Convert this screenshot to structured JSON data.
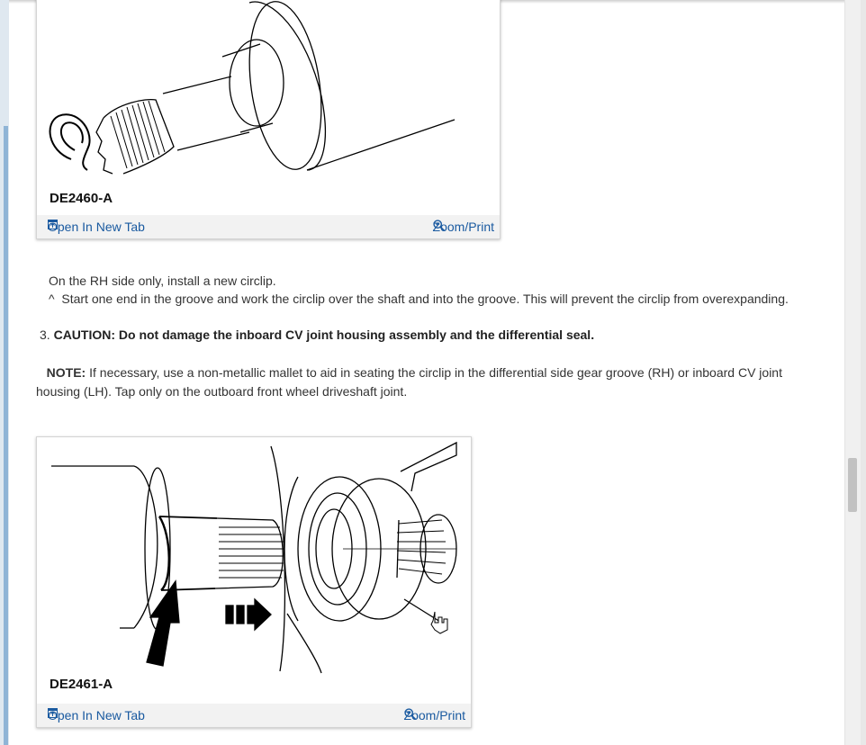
{
  "figures": [
    {
      "caption": "DE2460-A",
      "open_label": "Open In New Tab",
      "zoom_label": "Zoom/Print"
    },
    {
      "caption": "DE2461-A",
      "open_label": "Open In New Tab",
      "zoom_label": "Zoom/Print"
    }
  ],
  "step_intro": "On the RH side only, install a new circlip.",
  "bullet_marker": "^",
  "bullet_text": "Start one end in the groove and work the circlip over the shaft and into the groove. This will prevent the circlip from overexpanding.",
  "step3": {
    "number": "3.",
    "caution": "CAUTION: Do not damage the inboard CV joint housing assembly and the differential seal.",
    "note_label": "NOTE:",
    "note_text": " If necessary, use a non-metallic mallet to aid in seating the circlip in the differential side gear groove (RH) or inboard CV joint housing (LH). Tap only on the outboard front wheel driveshaft joint."
  },
  "icons": {
    "open": "open-new-tab-icon",
    "zoom": "magnifier-icon",
    "cursor": "hand-pointer-icon"
  },
  "colors": {
    "link": "#1a5aa0",
    "bar": "#f2f2f2",
    "accent_strip": "#8fb4d6"
  }
}
